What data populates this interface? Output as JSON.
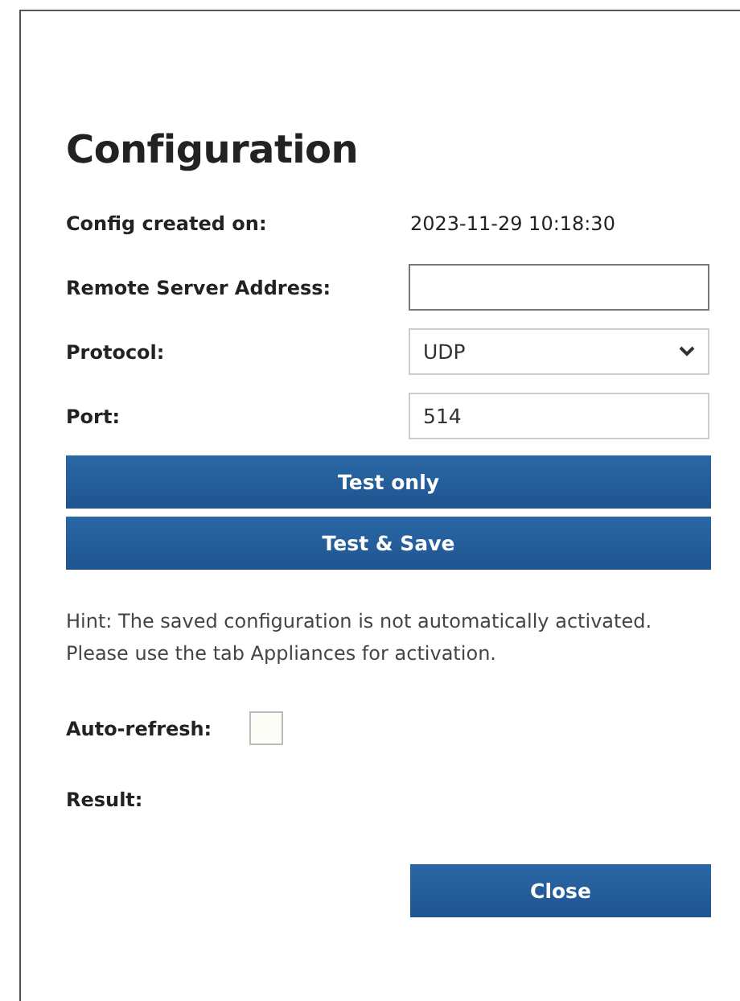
{
  "title": "Configuration",
  "fields": [
    {
      "kind": "text",
      "label": "Config created on:",
      "value": "2023-11-29 10:18:30"
    },
    {
      "kind": "input",
      "label": "Remote Server Address:"
    },
    {
      "kind": "select",
      "label": "Protocol:",
      "value": "UDP"
    },
    {
      "kind": "input",
      "label": "Port:",
      "value": "514"
    }
  ],
  "buttons": [
    "Test only",
    "Test & Save"
  ],
  "hint": [
    "Hint: The saved configuration is not automatically activated.",
    "Please use the tab Appliances for activation."
  ],
  "auto_refresh": {
    "label": "Auto-refresh:",
    "checked": false
  },
  "result_label": "Result:",
  "close_button": "Close"
}
